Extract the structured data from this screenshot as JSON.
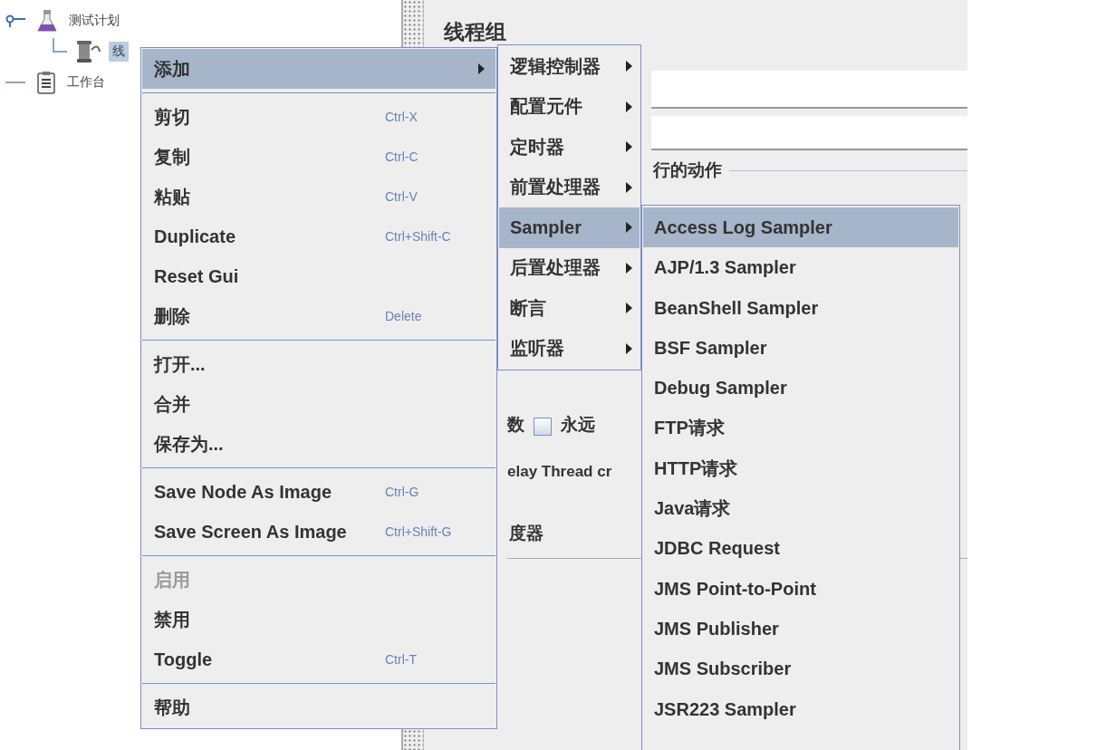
{
  "tree": [
    {
      "label": "测试计划",
      "kind": "plan",
      "selected": false,
      "children": [
        {
          "label": "线",
          "kind": "thread_group",
          "selected": true
        }
      ]
    },
    {
      "label": "工作台",
      "kind": "workbench",
      "selected": false
    }
  ],
  "panel": {
    "title": "线程组",
    "group_label": "行的动作",
    "loop_label": "数",
    "forever": {
      "label": "永远",
      "checked": false
    },
    "delay_label": "elay Thread cr",
    "scheduler_label": "度器"
  },
  "context_menu": {
    "items": [
      {
        "kind": "item",
        "label": "添加",
        "has_submenu": true,
        "selected": true,
        "disabled": false
      },
      {
        "kind": "separator"
      },
      {
        "kind": "item",
        "label": "剪切",
        "shortcut": "Ctrl-X",
        "has_submenu": false,
        "selected": false,
        "disabled": false
      },
      {
        "kind": "item",
        "label": "复制",
        "shortcut": "Ctrl-C",
        "has_submenu": false,
        "selected": false,
        "disabled": false
      },
      {
        "kind": "item",
        "label": "粘贴",
        "shortcut": "Ctrl-V",
        "has_submenu": false,
        "selected": false,
        "disabled": false
      },
      {
        "kind": "item",
        "label": "Duplicate",
        "shortcut": "Ctrl+Shift-C",
        "has_submenu": false,
        "selected": false,
        "disabled": false
      },
      {
        "kind": "item",
        "label": "Reset Gui",
        "has_submenu": false,
        "selected": false,
        "disabled": false
      },
      {
        "kind": "item",
        "label": "删除",
        "shortcut": "Delete",
        "has_submenu": false,
        "selected": false,
        "disabled": false
      },
      {
        "kind": "separator"
      },
      {
        "kind": "item",
        "label": "打开...",
        "has_submenu": false,
        "selected": false,
        "disabled": false
      },
      {
        "kind": "item",
        "label": "合并",
        "has_submenu": false,
        "selected": false,
        "disabled": false
      },
      {
        "kind": "item",
        "label": "保存为...",
        "has_submenu": false,
        "selected": false,
        "disabled": false
      },
      {
        "kind": "separator"
      },
      {
        "kind": "item",
        "label": "Save Node As Image",
        "shortcut": "Ctrl-G",
        "has_submenu": false,
        "selected": false,
        "disabled": false
      },
      {
        "kind": "item",
        "label": "Save Screen As Image",
        "shortcut": "Ctrl+Shift-G",
        "has_submenu": false,
        "selected": false,
        "disabled": false
      },
      {
        "kind": "separator"
      },
      {
        "kind": "item",
        "label": "启用",
        "has_submenu": false,
        "selected": false,
        "disabled": true
      },
      {
        "kind": "item",
        "label": "禁用",
        "has_submenu": false,
        "selected": false,
        "disabled": false
      },
      {
        "kind": "item",
        "label": "Toggle",
        "shortcut": "Ctrl-T",
        "has_submenu": false,
        "selected": false,
        "disabled": false
      },
      {
        "kind": "separator"
      },
      {
        "kind": "item",
        "label": "帮助",
        "has_submenu": false,
        "selected": false,
        "disabled": false
      }
    ]
  },
  "add_submenu": {
    "items": [
      {
        "label": "逻辑控制器",
        "selected": false
      },
      {
        "label": "配置元件",
        "selected": false
      },
      {
        "label": "定时器",
        "selected": false
      },
      {
        "label": "前置处理器",
        "selected": false
      },
      {
        "label": "Sampler",
        "selected": true
      },
      {
        "label": "后置处理器",
        "selected": false
      },
      {
        "label": "断言",
        "selected": false
      },
      {
        "label": "监听器",
        "selected": false
      }
    ]
  },
  "sampler_submenu": {
    "items": [
      {
        "label": "Access Log Sampler",
        "selected": true
      },
      {
        "label": "AJP/1.3 Sampler",
        "selected": false
      },
      {
        "label": "BeanShell Sampler",
        "selected": false
      },
      {
        "label": "BSF Sampler",
        "selected": false
      },
      {
        "label": "Debug Sampler",
        "selected": false
      },
      {
        "label": "FTP请求",
        "selected": false
      },
      {
        "label": "HTTP请求",
        "selected": false
      },
      {
        "label": "Java请求",
        "selected": false
      },
      {
        "label": "JDBC Request",
        "selected": false
      },
      {
        "label": "JMS Point-to-Point",
        "selected": false
      },
      {
        "label": "JMS Publisher",
        "selected": false
      },
      {
        "label": "JMS Subscriber",
        "selected": false
      },
      {
        "label": "JSR223 Sampler",
        "selected": false
      }
    ]
  }
}
